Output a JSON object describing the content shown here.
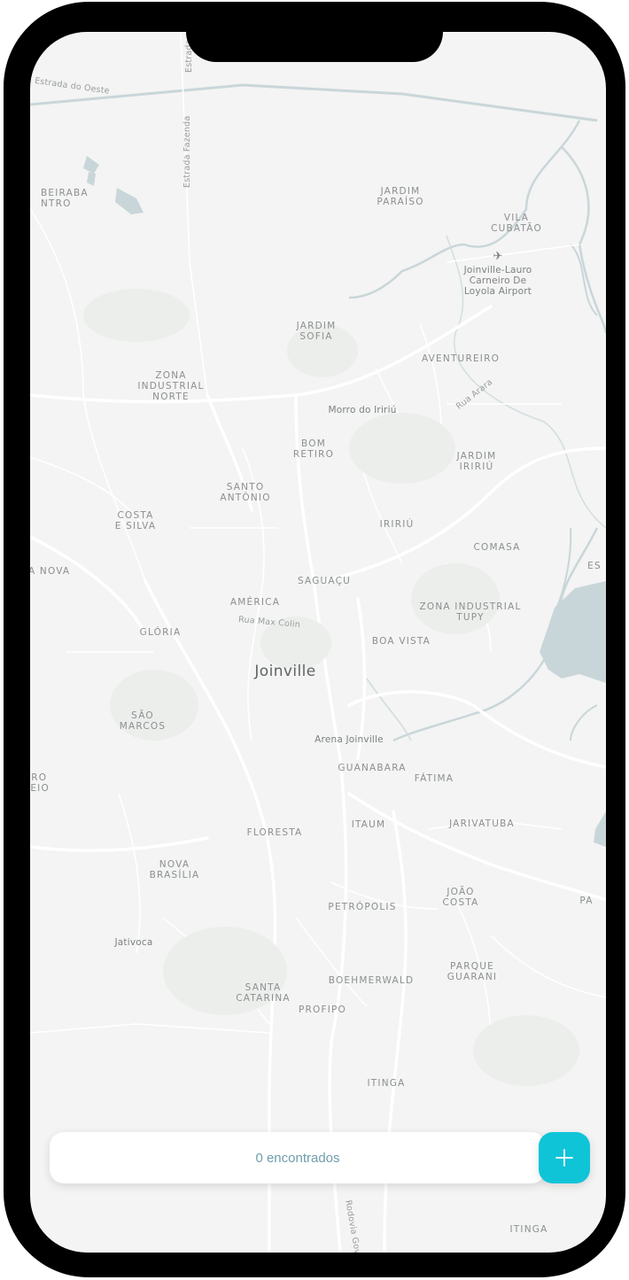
{
  "map": {
    "city": "Joinville",
    "neighborhoods": {
      "jardim_paraiso": "JARDIM\nPARAÍSO",
      "vila_cubatao": "VILA\nCUBATÃO",
      "jardim_sofia": "JARDIM\nSOFIA",
      "aventureiro": "AVENTUREIRO",
      "zona_industrial_norte": "ZONA\nINDUSTRIAL\nNORTE",
      "bom_retiro": "BOM\nRETIRO",
      "jardim_iririu": "JARDIM\nIRIRIÚ",
      "santo_antonio": "SANTO\nANTÔNIO",
      "costa_e_silva": "COSTA\nE SILVA",
      "iririu": "IRIRIÚ",
      "comasa": "COMASA",
      "vila_nova": "LA NOVA",
      "saguacu": "SAGUAÇU",
      "america": "AMÉRICA",
      "zona_industrial_tupy": "ZONA INDUSTRIAL\nTUPY",
      "gloria": "GLÓRIA",
      "boa_vista": "BOA VISTA",
      "sao_marcos": "SÃO\nMARCOS",
      "guanabara": "GUANABARA",
      "fatima": "FÁTIMA",
      "ribeirao": "RRO\nMEIO",
      "floresta": "FLORESTA",
      "itaum": "ITAUM",
      "jarivatuba": "JARIVATUBA",
      "nova_brasilia": "NOVA\nBRASÍLIA",
      "joao_costa": "JOÃO\nCOSTA",
      "petropolis": "PETRÓPOLIS",
      "parque_guarani": "PARQUE\nGUARANI",
      "boehmerwald": "BOEHMERWALD",
      "santa_catarina": "SANTA\nCATARINA",
      "profipo": "PROFIPO",
      "itinga": "ITINGA",
      "itinga_2": "ITINGA",
      "beiraba": "BEIRABA\nNTRO",
      "es": "ES",
      "pa": "PA"
    },
    "places": {
      "airport": "Joinville-Lauro\nCarneiro De\nLoyola Airport",
      "morro": "Morro do Iririú",
      "arena": "Arena Joinville",
      "jativoca": "Jativoca"
    },
    "roads": {
      "estrada_oeste": "Estrada do Oeste",
      "estrada_fazenda": "Estrada Fazenda",
      "rua_max_colin": "Rua Max Colin",
      "rua_arara": "Rua Arara",
      "rodovia": "Rodovia Gove",
      "estrada_top": "Estrada"
    },
    "icons": {
      "airport": "airplane-icon"
    }
  },
  "bottom_bar": {
    "count_text": "0 encontrados",
    "add_icon": "plus-icon"
  },
  "colors": {
    "accent": "#10c4d8",
    "water": "#c9d6d9",
    "map_bg": "#f3f4f3",
    "road": "#ffffff",
    "count_text": "#6f9dab"
  }
}
